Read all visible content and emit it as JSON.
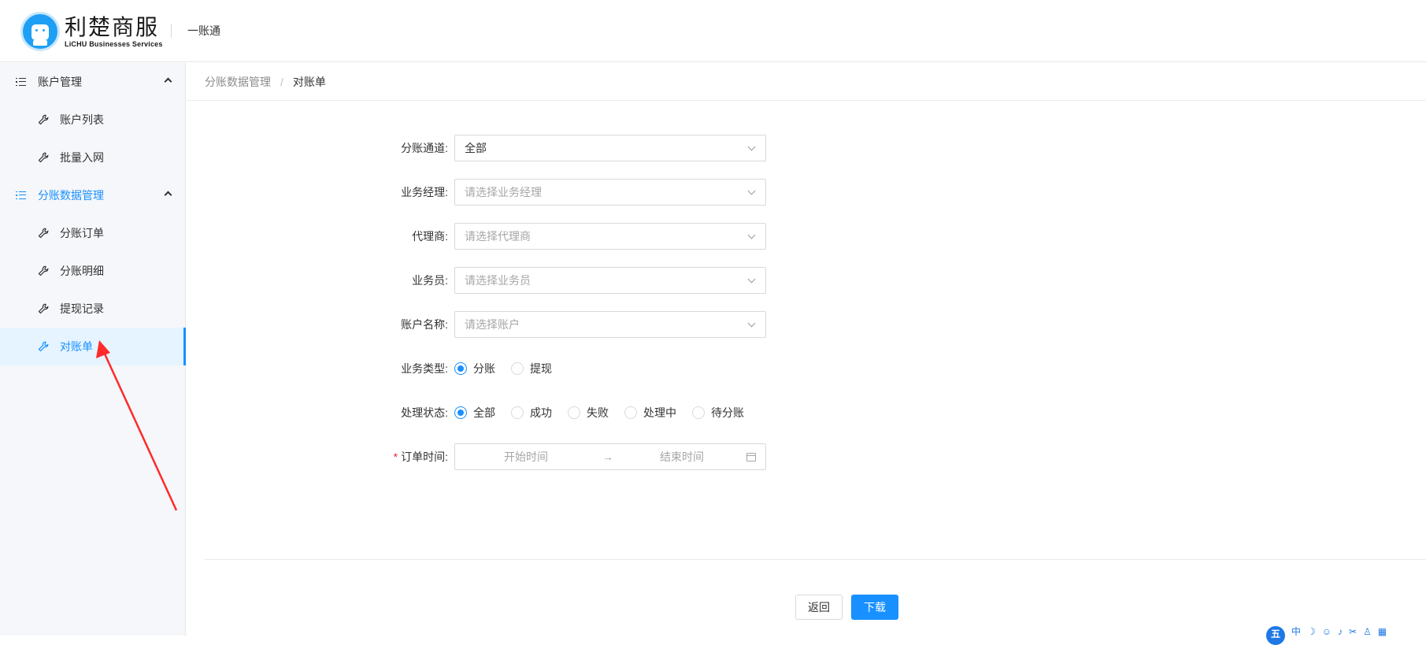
{
  "header": {
    "brand_cn": "利楚商服",
    "brand_en": "LiCHU Businesses Services",
    "subtitle": "一账通"
  },
  "sidebar": {
    "groups": [
      {
        "label": "账户管理",
        "items": [
          {
            "label": "账户列表"
          },
          {
            "label": "批量入网"
          }
        ]
      },
      {
        "label": "分账数据管理",
        "items": [
          {
            "label": "分账订单"
          },
          {
            "label": "分账明细"
          },
          {
            "label": "提现记录"
          },
          {
            "label": "对账单"
          }
        ]
      }
    ],
    "selected": "对账单"
  },
  "breadcrumb": {
    "parent": "分账数据管理",
    "separator": "/",
    "current": "对账单"
  },
  "form": {
    "channel": {
      "label": "分账通道",
      "value": "全部"
    },
    "manager": {
      "label": "业务经理",
      "placeholder": "请选择业务经理"
    },
    "agent": {
      "label": "代理商",
      "placeholder": "请选择代理商"
    },
    "salesman": {
      "label": "业务员",
      "placeholder": "请选择业务员"
    },
    "account": {
      "label": "账户名称",
      "placeholder": "请选择账户"
    },
    "biz_type": {
      "label": "业务类型",
      "options": [
        "分账",
        "提现"
      ],
      "selected": "分账"
    },
    "status": {
      "label": "处理状态",
      "options": [
        "全部",
        "成功",
        "失败",
        "处理中",
        "待分账"
      ],
      "selected": "全部"
    },
    "order_time": {
      "label": "订单时间",
      "required": "*",
      "start_placeholder": "开始时间",
      "arrow": "→",
      "end_placeholder": "结束时间"
    }
  },
  "actions": {
    "back": "返回",
    "download": "下载"
  },
  "colors": {
    "accent": "#1890ff",
    "annotation_arrow": "#ff2a2a",
    "sidebar_bg": "#f5f7fa",
    "selected_bg": "#e6f4ff"
  },
  "tray": {
    "logo_char": "五",
    "input_mode": "中"
  }
}
